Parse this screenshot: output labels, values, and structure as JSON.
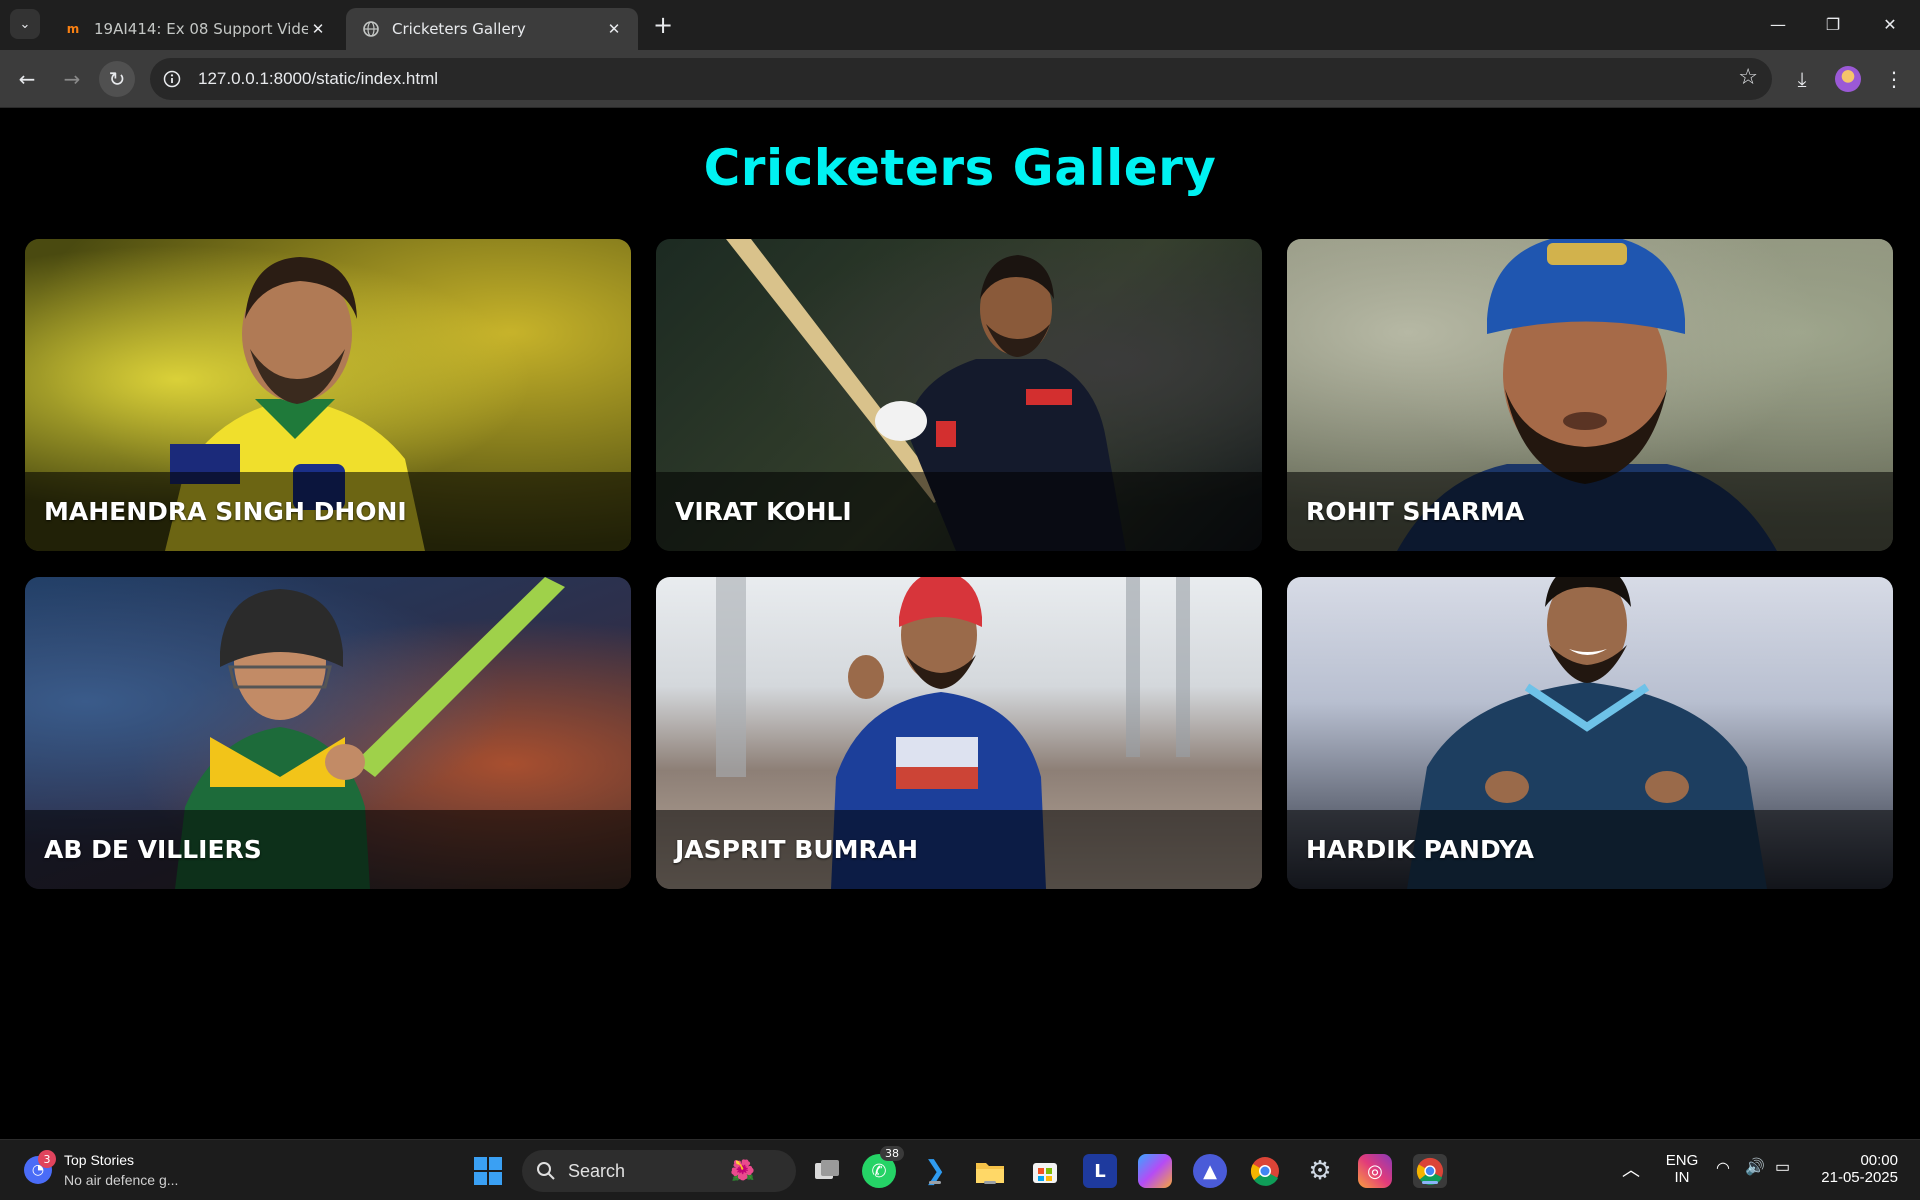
{
  "browser": {
    "tabs": [
      {
        "title": "19AI414: Ex 08 Support Video |",
        "favicon": "moodle-icon",
        "active": false
      },
      {
        "title": "Cricketers Gallery",
        "favicon": "globe-icon",
        "active": true
      }
    ],
    "new_tab_label": "+",
    "address": "127.0.0.1:8000/static/index.html"
  },
  "page": {
    "title": "Cricketers Gallery",
    "accent_color": "#00f2f2",
    "cards": [
      {
        "name": "MAHENDRA SINGH DHONI"
      },
      {
        "name": "VIRAT KOHLI"
      },
      {
        "name": "ROHIT SHARMA"
      },
      {
        "name": "AB DE VILLIERS"
      },
      {
        "name": "JASPRIT BUMRAH"
      },
      {
        "name": "HARDIK PANDYA"
      }
    ]
  },
  "taskbar": {
    "news": {
      "badge": "3",
      "title": "Top Stories",
      "subtitle": "No air defence g..."
    },
    "search_label": "Search",
    "whatsapp_badge": "38",
    "language": {
      "line1": "ENG",
      "line2": "IN"
    },
    "clock": {
      "time": "00:00",
      "date": "21-05-2025"
    }
  }
}
